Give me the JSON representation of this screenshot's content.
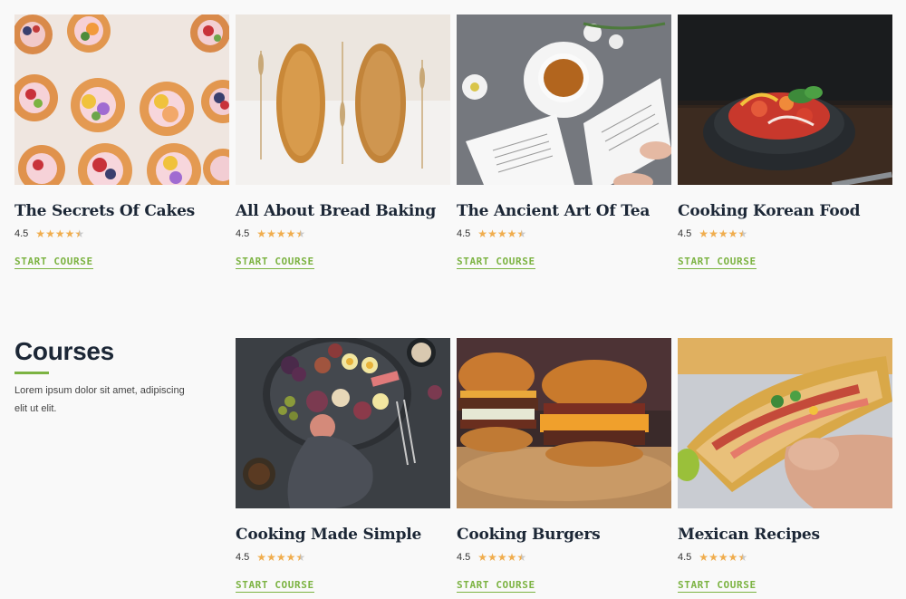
{
  "rating_label": "4.5",
  "cta_label": "START COURSE",
  "intro": {
    "heading": "Courses",
    "text": "Lorem ipsum dolor sit amet, adipiscing elit ut elit."
  },
  "courses": [
    {
      "title": "The Secrets Of Cakes",
      "rating": 4.5,
      "image": "cakes-photo"
    },
    {
      "title": "All About Bread Baking",
      "rating": 4.5,
      "image": "bread-photo"
    },
    {
      "title": "The Ancient Art Of Tea",
      "rating": 4.5,
      "image": "tea-photo"
    },
    {
      "title": "Cooking Korean Food",
      "rating": 4.5,
      "image": "korean-food-photo"
    },
    {
      "title": "Cooking Made Simple",
      "rating": 4.5,
      "image": "platter-photo"
    },
    {
      "title": "Cooking Burgers",
      "rating": 4.5,
      "image": "burgers-photo"
    },
    {
      "title": "Mexican Recipes",
      "rating": 4.5,
      "image": "taco-photo"
    }
  ],
  "colors": {
    "accent": "#7cb342",
    "star": "#f0ad4e",
    "heading": "#1c2736",
    "background": "#f9f9f9"
  }
}
